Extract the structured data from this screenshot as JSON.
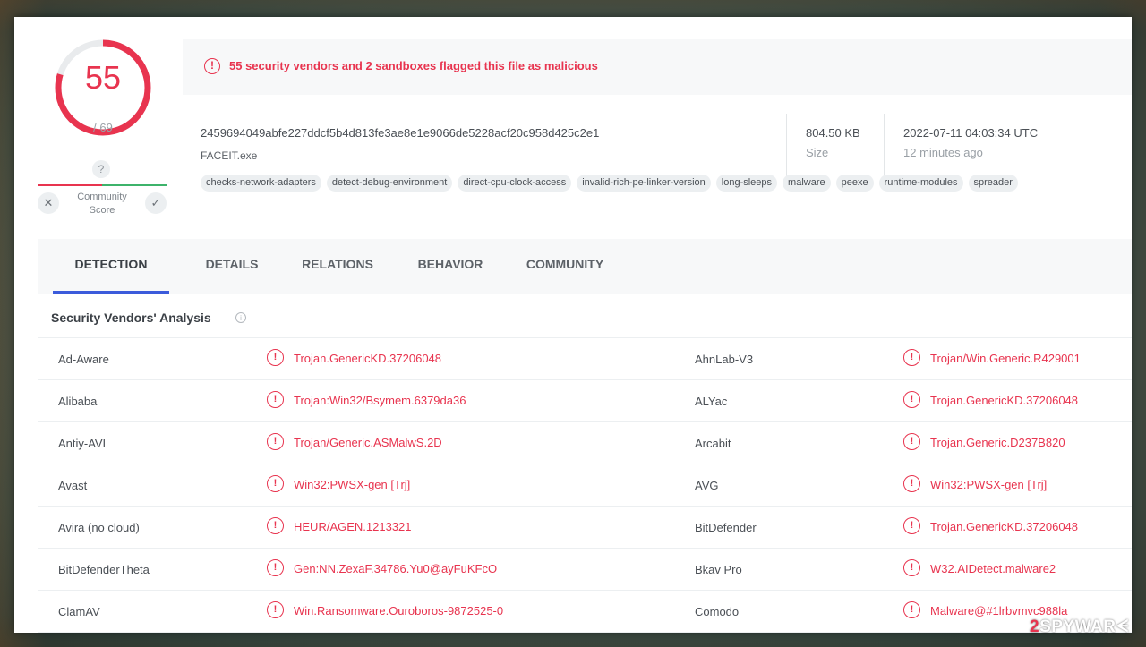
{
  "score": {
    "detections": "55",
    "total": "/ 69",
    "fraction": 0.797,
    "ring_color": "#e8344f",
    "track_color": "#e9ebed"
  },
  "community": {
    "question": "?",
    "label_line1": "Community",
    "label_line2": "Score",
    "dislike": "✕",
    "like": "✓"
  },
  "alert": {
    "icon": "exclamation-circle",
    "text": "55 security vendors and 2 sandboxes flagged this file as malicious"
  },
  "file": {
    "hash": "2459694049abfe227ddcf5b4d813fe3ae8e1e9066de5228acf20c958d425c2e1",
    "name": "FACEIT.exe",
    "size": "804.50 KB",
    "size_label": "Size",
    "date": "2022-07-11 04:03:34 UTC",
    "date_ago": "12 minutes ago",
    "tags": [
      "checks-network-adapters",
      "detect-debug-environment",
      "direct-cpu-clock-access",
      "invalid-rich-pe-linker-version",
      "long-sleeps",
      "malware",
      "peexe",
      "runtime-modules",
      "spreader"
    ]
  },
  "tabs": [
    "DETECTION",
    "DETAILS",
    "RELATIONS",
    "BEHAVIOR",
    "COMMUNITY"
  ],
  "section": {
    "title": "Security Vendors' Analysis",
    "info_icon": "i"
  },
  "vendors": [
    {
      "left_name": "Ad-Aware",
      "left_result": "Trojan.GenericKD.37206048",
      "right_name": "AhnLab-V3",
      "right_result": "Trojan/Win.Generic.R429001"
    },
    {
      "left_name": "Alibaba",
      "left_result": "Trojan:Win32/Bsymem.6379da36",
      "right_name": "ALYac",
      "right_result": "Trojan.GenericKD.37206048"
    },
    {
      "left_name": "Antiy-AVL",
      "left_result": "Trojan/Generic.ASMalwS.2D",
      "right_name": "Arcabit",
      "right_result": "Trojan.Generic.D237B820"
    },
    {
      "left_name": "Avast",
      "left_result": "Win32:PWSX-gen [Trj]",
      "right_name": "AVG",
      "right_result": "Win32:PWSX-gen [Trj]"
    },
    {
      "left_name": "Avira (no cloud)",
      "left_result": "HEUR/AGEN.1213321",
      "right_name": "BitDefender",
      "right_result": "Trojan.GenericKD.37206048"
    },
    {
      "left_name": "BitDefenderTheta",
      "left_result": "Gen:NN.ZexaF.34786.Yu0@ayFuKFcO",
      "right_name": "Bkav Pro",
      "right_result": "W32.AIDetect.malware2"
    },
    {
      "left_name": "ClamAV",
      "left_result": "Win.Ransomware.Ouroboros-9872525-0",
      "right_name": "Comodo",
      "right_result": "Malware@#1lrbvmvc988la"
    }
  ],
  "watermark": {
    "prefix": "2",
    "rest": "SPYWAR",
    "suffix": "ᗕ"
  }
}
